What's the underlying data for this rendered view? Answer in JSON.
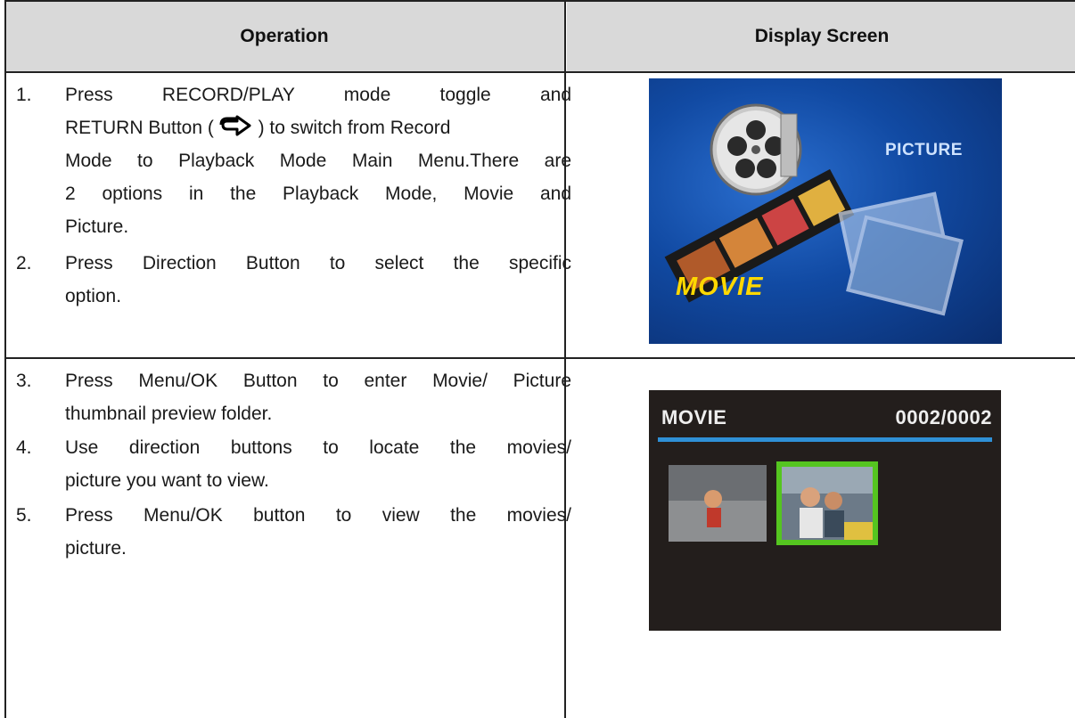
{
  "headers": {
    "operation": "Operation",
    "display_screen": "Display Screen"
  },
  "steps": [
    {
      "num": "1.",
      "lines": [
        "Press RECORD/PLAY mode toggle and",
        "RETURN Button (",
        ") to switch from Record",
        "Mode to Playback Mode Main Menu.There are",
        "2 options in the Playback Mode, Movie and",
        "Picture."
      ]
    },
    {
      "num": "2.",
      "lines": [
        "Press Direction Button to select the specific",
        "option."
      ]
    },
    {
      "num": "3.",
      "lines": [
        "Press Menu/OK Button to enter Movie/ Picture",
        "thumbnail preview folder."
      ]
    },
    {
      "num": "4.",
      "lines": [
        "Use direction buttons to locate the movies/",
        "picture you want to view."
      ]
    },
    {
      "num": "5.",
      "lines": [
        "Press Menu/OK button to view the movies/",
        "picture."
      ]
    }
  ],
  "screen1": {
    "picture_label": "PICTURE",
    "movie_label": "MOVIE",
    "colors": {
      "bg": "#114aa3",
      "movie": "#ffd800",
      "picture": "#cfe3ff"
    }
  },
  "screen2": {
    "title": "MOVIE",
    "counter": "0002/0002",
    "colors": {
      "bar": "#2f90d6",
      "selection": "#55c520",
      "bg": "#231e1c"
    }
  },
  "icons": {
    "return": "return-arrow-icon"
  }
}
